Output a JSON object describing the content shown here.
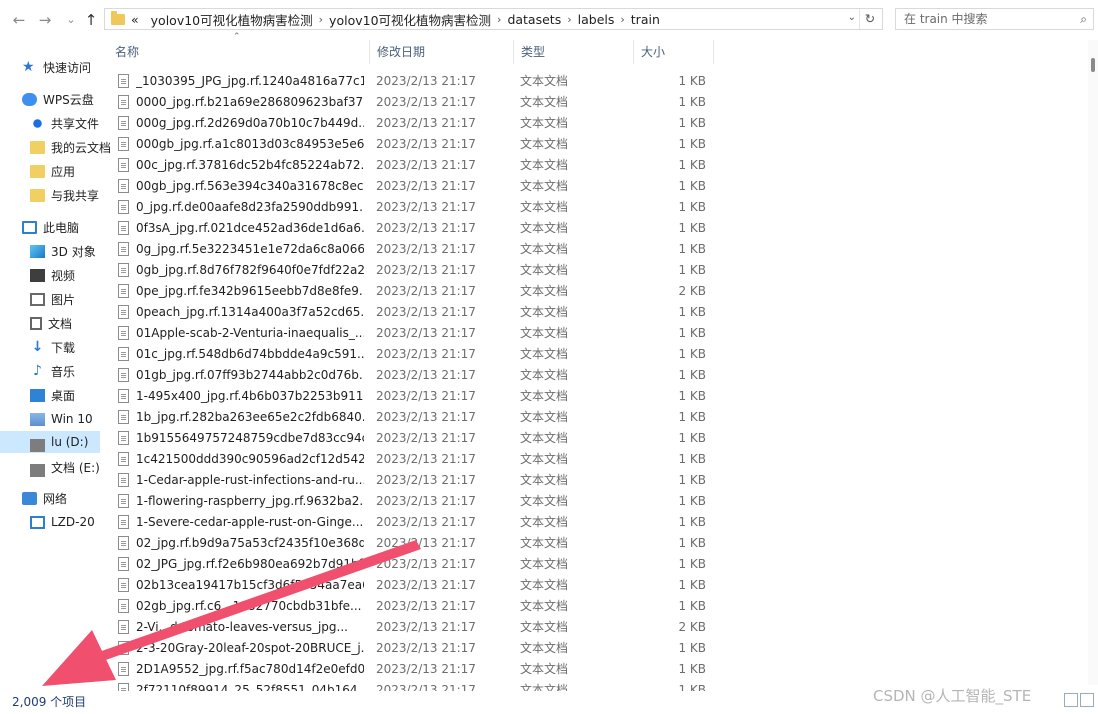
{
  "nav": {
    "back": "←",
    "forward": "→",
    "recent": "⌄",
    "up": "↑"
  },
  "address": {
    "overflow": "«",
    "segments": [
      "yolov10可视化植物病害检测",
      "yolov10可视化植物病害检测",
      "datasets",
      "labels",
      "train"
    ],
    "separator": "›",
    "dropdown": "⌄",
    "refresh": "↻"
  },
  "search": {
    "placeholder": "在 train 中搜索",
    "icon": "search-icon"
  },
  "sidebar": {
    "items": [
      {
        "label": "快速访问",
        "icon": "star-icon"
      },
      {
        "label": "WPS云盘",
        "icon": "cloud-icon"
      },
      {
        "label": "共享文件",
        "icon": "share-icon"
      },
      {
        "label": "我的云文档",
        "icon": "folder-icon"
      },
      {
        "label": "应用",
        "icon": "folder-icon"
      },
      {
        "label": "与我共享",
        "icon": "folder-icon"
      },
      {
        "label": "此电脑",
        "icon": "computer-icon"
      },
      {
        "label": "3D 对象",
        "icon": "3d-objects-icon"
      },
      {
        "label": "视频",
        "icon": "video-icon"
      },
      {
        "label": "图片",
        "icon": "pictures-icon"
      },
      {
        "label": "文档",
        "icon": "documents-icon"
      },
      {
        "label": "下载",
        "icon": "download-icon"
      },
      {
        "label": "音乐",
        "icon": "music-icon"
      },
      {
        "label": "桌面",
        "icon": "desktop-icon"
      },
      {
        "label": "Win 10",
        "icon": "windows-drive-icon"
      },
      {
        "label": "lu (D:)",
        "icon": "drive-icon",
        "selected": true
      },
      {
        "label": "文档 (E:)",
        "icon": "drive-icon"
      },
      {
        "label": "网络",
        "icon": "network-icon"
      },
      {
        "label": "LZD-20",
        "icon": "monitor-icon"
      }
    ]
  },
  "columns": [
    "名称",
    "修改日期",
    "类型",
    "大小"
  ],
  "files": [
    {
      "name": "_1030395_JPG_jpg.rf.1240a4816a77c1...",
      "date": "2023/2/13 21:17",
      "type": "文本文档",
      "size": "1 KB"
    },
    {
      "name": "0000_jpg.rf.b21a69e286809623baf37...",
      "date": "2023/2/13 21:17",
      "type": "文本文档",
      "size": "1 KB"
    },
    {
      "name": "000g_jpg.rf.2d269d0a70b10c7b449d...",
      "date": "2023/2/13 21:17",
      "type": "文本文档",
      "size": "1 KB"
    },
    {
      "name": "000gb_jpg.rf.a1c8013d03c84953e5e6...",
      "date": "2023/2/13 21:17",
      "type": "文本文档",
      "size": "1 KB"
    },
    {
      "name": "00c_jpg.rf.37816dc52b4fc85224ab72...",
      "date": "2023/2/13 21:17",
      "type": "文本文档",
      "size": "1 KB"
    },
    {
      "name": "00gb_jpg.rf.563e394c340a31678c8ec...",
      "date": "2023/2/13 21:17",
      "type": "文本文档",
      "size": "1 KB"
    },
    {
      "name": "0_jpg.rf.de00aafe8d23fa2590ddb991...",
      "date": "2023/2/13 21:17",
      "type": "文本文档",
      "size": "1 KB"
    },
    {
      "name": "0f3sA_jpg.rf.021dce452ad36de1d6a6...",
      "date": "2023/2/13 21:17",
      "type": "文本文档",
      "size": "1 KB"
    },
    {
      "name": "0g_jpg.rf.5e3223451e1e72da6c8a066...",
      "date": "2023/2/13 21:17",
      "type": "文本文档",
      "size": "1 KB"
    },
    {
      "name": "0gb_jpg.rf.8d76f782f9640f0e7fdf22a2...",
      "date": "2023/2/13 21:17",
      "type": "文本文档",
      "size": "1 KB"
    },
    {
      "name": "0pe_jpg.rf.fe342b9615eebb7d8e8fe9...",
      "date": "2023/2/13 21:17",
      "type": "文本文档",
      "size": "2 KB"
    },
    {
      "name": "0peach_jpg.rf.1314a400a3f7a52cd65...",
      "date": "2023/2/13 21:17",
      "type": "文本文档",
      "size": "1 KB"
    },
    {
      "name": "01Apple-scab-2-Venturia-inaequalis_...",
      "date": "2023/2/13 21:17",
      "type": "文本文档",
      "size": "1 KB"
    },
    {
      "name": "01c_jpg.rf.548db6d74bbdde4a9c591...",
      "date": "2023/2/13 21:17",
      "type": "文本文档",
      "size": "1 KB"
    },
    {
      "name": "01gb_jpg.rf.07ff93b2744abb2c0d76b...",
      "date": "2023/2/13 21:17",
      "type": "文本文档",
      "size": "1 KB"
    },
    {
      "name": "1-495x400_jpg.rf.4b6b037b2253b911...",
      "date": "2023/2/13 21:17",
      "type": "文本文档",
      "size": "1 KB"
    },
    {
      "name": "1b_jpg.rf.282ba263ee65e2c2fdb6840...",
      "date": "2023/2/13 21:17",
      "type": "文本文档",
      "size": "1 KB"
    },
    {
      "name": "1b9155649757248759cdbe7d83cc94c...",
      "date": "2023/2/13 21:17",
      "type": "文本文档",
      "size": "1 KB"
    },
    {
      "name": "1c421500ddd390c90596ad2cf12d542...",
      "date": "2023/2/13 21:17",
      "type": "文本文档",
      "size": "1 KB"
    },
    {
      "name": "1-Cedar-apple-rust-infections-and-ru...",
      "date": "2023/2/13 21:17",
      "type": "文本文档",
      "size": "1 KB"
    },
    {
      "name": "1-flowering-raspberry_jpg.rf.9632ba2...",
      "date": "2023/2/13 21:17",
      "type": "文本文档",
      "size": "1 KB"
    },
    {
      "name": "1-Severe-cedar-apple-rust-on-Ginge...",
      "date": "2023/2/13 21:17",
      "type": "文本文档",
      "size": "1 KB"
    },
    {
      "name": "02_jpg.rf.b9d9a75a53cf2435f10e368d...",
      "date": "2023/2/13 21:17",
      "type": "文本文档",
      "size": "1 KB"
    },
    {
      "name": "02_JPG_jpg.rf.f2e6b980ea692b7d91bf...",
      "date": "2023/2/13 21:17",
      "type": "文本文档",
      "size": "1 KB"
    },
    {
      "name": "02b13cea19417b15cf3d6f5354aa7ea6...",
      "date": "2023/2/13 21:17",
      "type": "文本文档",
      "size": "1 KB"
    },
    {
      "name": "02gb_jpg.rf.c6...1982770cbdb31bfe...",
      "date": "2023/2/13 21:17",
      "type": "文本文档",
      "size": "1 KB"
    },
    {
      "name": "2-Vi...d-tomato-leaves-versus_jpg...",
      "date": "2023/2/13 21:17",
      "type": "文本文档",
      "size": "2 KB"
    },
    {
      "name": "2-3-20Gray-20leaf-20spot-20BRUCE_j...",
      "date": "2023/2/13 21:17",
      "type": "文本文档",
      "size": "1 KB"
    },
    {
      "name": "2D1A9552_jpg.rf.f5ac780d14f2e0efd0...",
      "date": "2023/2/13 21:17",
      "type": "文本文档",
      "size": "1 KB"
    },
    {
      "name": "2f72110f89914_25_52f8551_04b164...",
      "date": "2023/2/13 21:17",
      "type": "文本文档",
      "size": "1 KB"
    }
  ],
  "status": {
    "count": "2,009 个项目"
  },
  "watermark": "CSDN @人工智能_STE",
  "overlay": {
    "arrow_color": "#f0506e"
  }
}
